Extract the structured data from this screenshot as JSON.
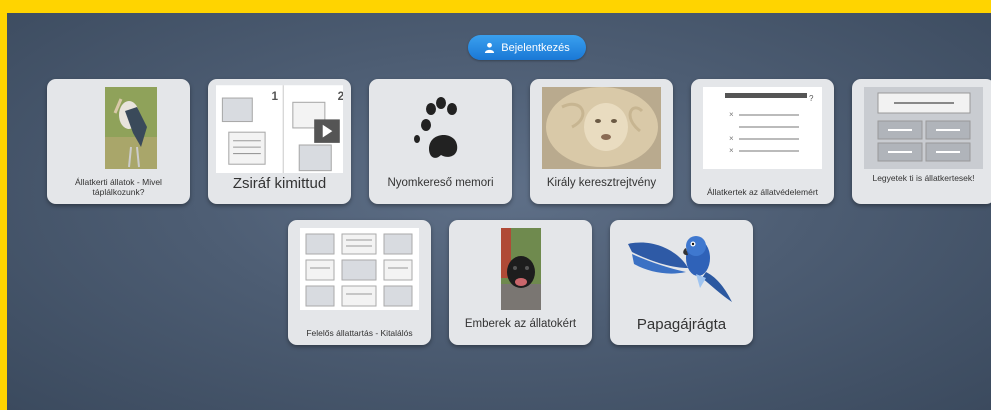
{
  "login": {
    "label": "Bejelentkezés",
    "icon": "user-icon"
  },
  "cards": [
    {
      "label": "Állatkerti állatok - Mivel táplálkozunk?",
      "thumb": "stork-photo"
    },
    {
      "label": "Zsiráf kimittud",
      "thumb": "quiz-layout-icon"
    },
    {
      "label": "Nyomkereső memori",
      "thumb": "paw-print-icon"
    },
    {
      "label": "Király keresztrejtvény",
      "thumb": "lion-photo"
    },
    {
      "label": "Állatkertek az állatvédelemért",
      "thumb": "checklist-icon"
    },
    {
      "label": "Legyetek ti is állatkertesek!",
      "thumb": "match-layout-icon"
    },
    {
      "label": "Felelős állattartás - Kitalálós",
      "thumb": "grid-layout-icon"
    },
    {
      "label": "Emberek az állatokért",
      "thumb": "dog-photo"
    },
    {
      "label": "Papagájrágta",
      "thumb": "parrot-image"
    }
  ],
  "colors": {
    "frame": "#ffd400",
    "button": "#1a78d6",
    "card": "#e4e6e9"
  }
}
